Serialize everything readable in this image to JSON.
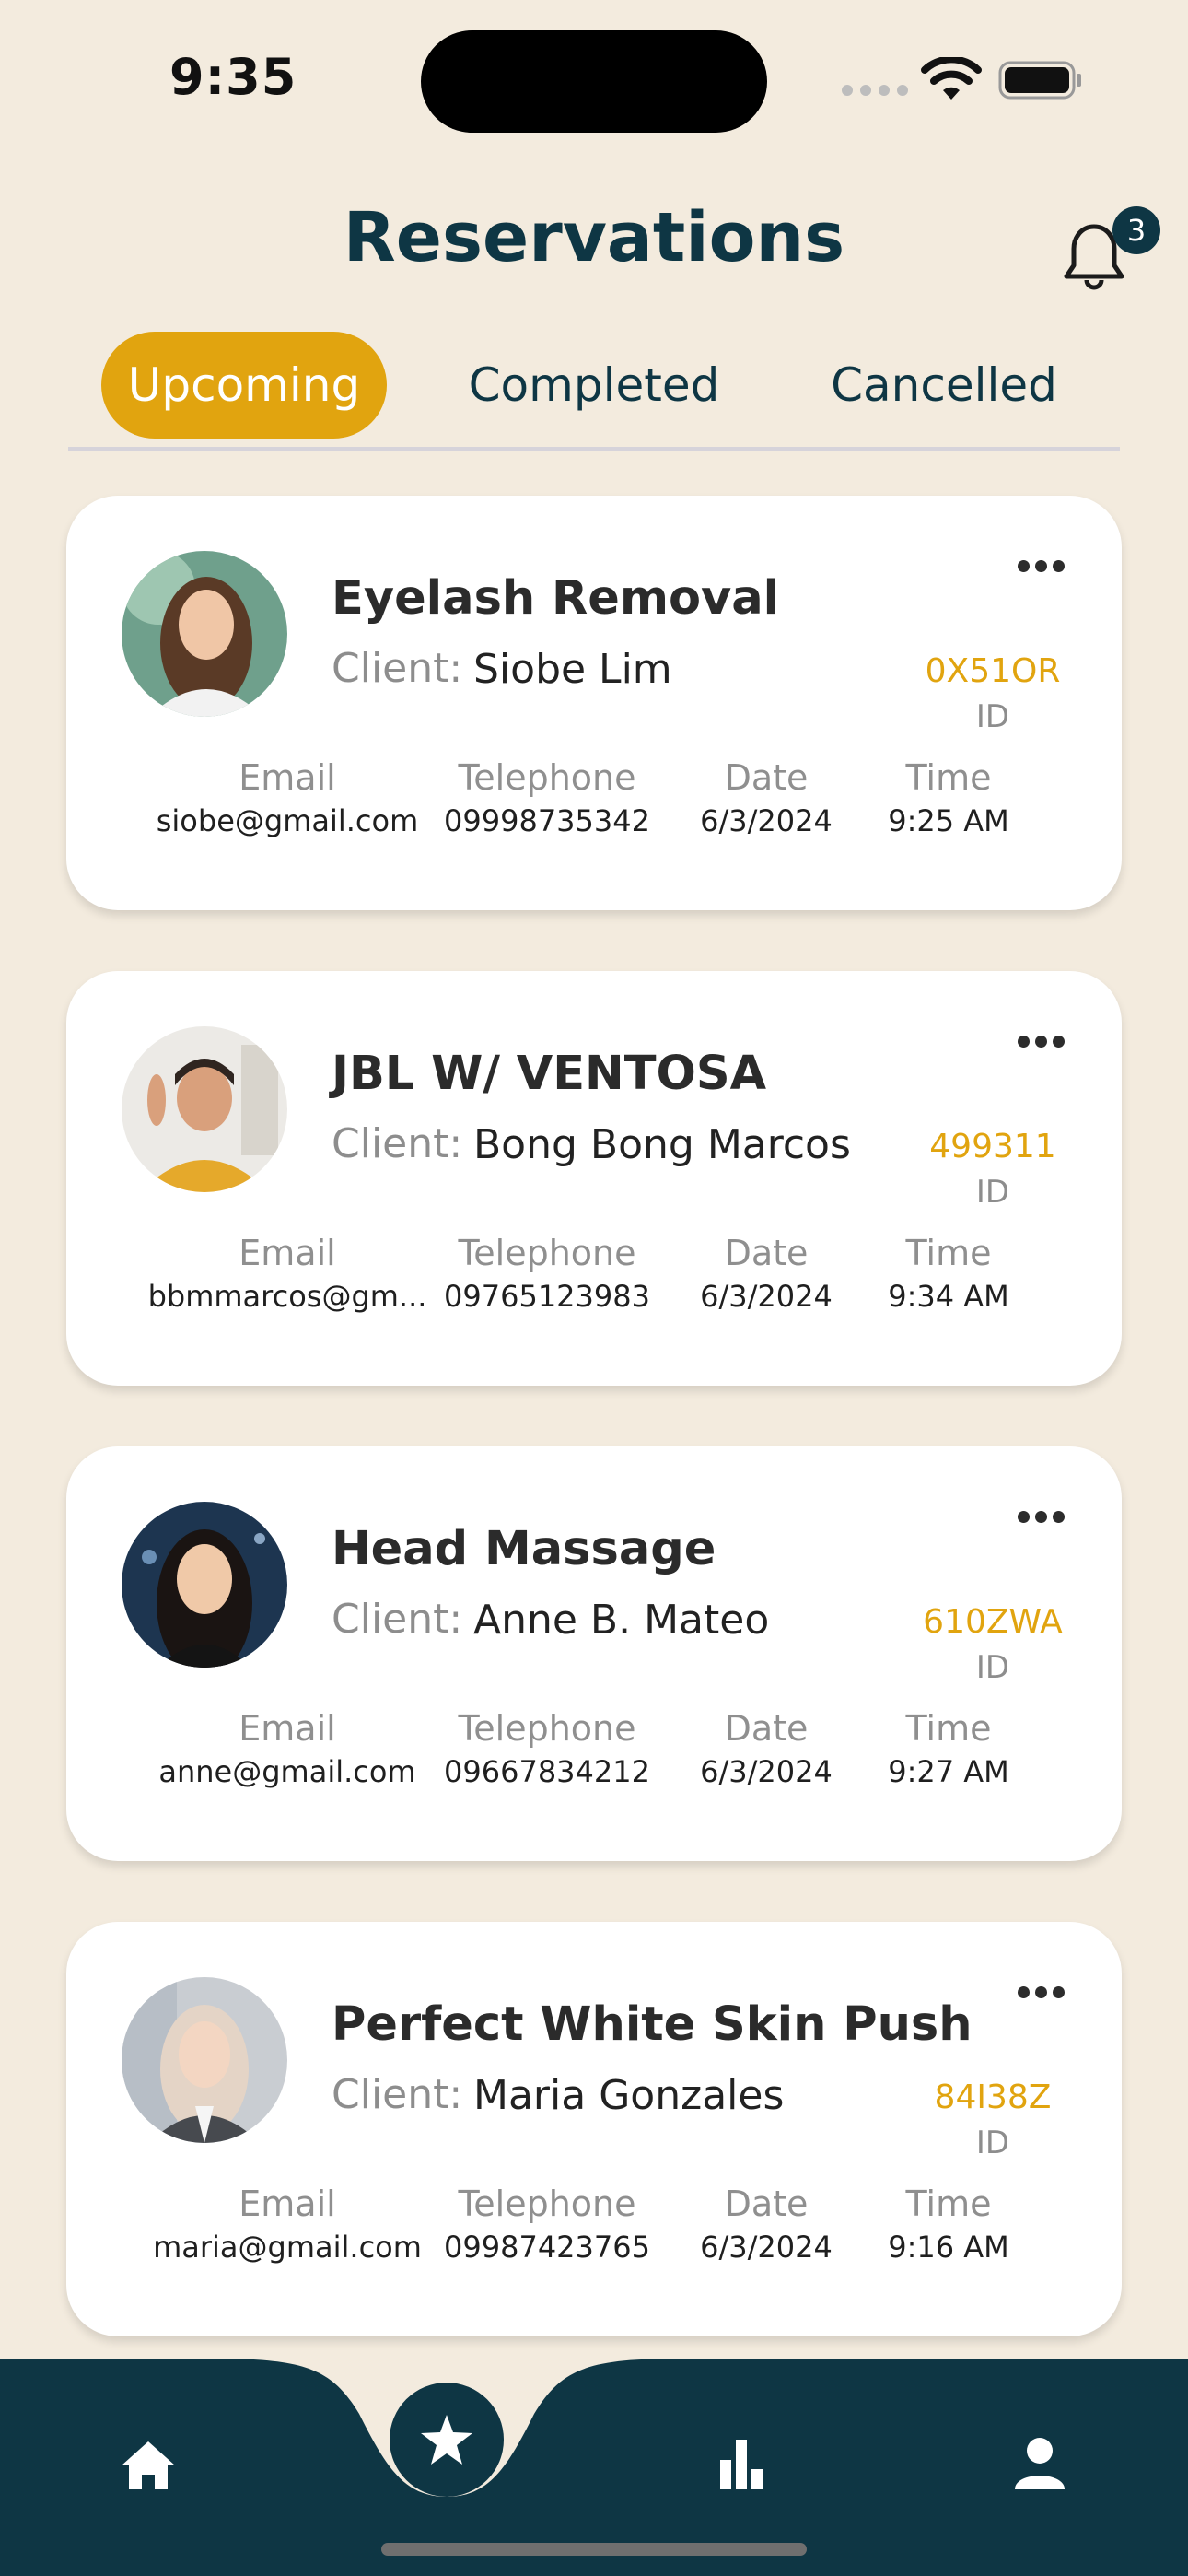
{
  "status_bar": {
    "time": "9:35"
  },
  "header": {
    "title": "Reservations",
    "notification_count": "3"
  },
  "tabs": [
    {
      "label": "Upcoming",
      "active": true
    },
    {
      "label": "Completed",
      "active": false
    },
    {
      "label": "Cancelled",
      "active": false
    }
  ],
  "columns": {
    "email": "Email",
    "telephone": "Telephone",
    "date": "Date",
    "time": "Time"
  },
  "client_label": "Client:",
  "id_label": "ID",
  "reservations": [
    {
      "service": "Eyelash Removal",
      "client": "Siobe Lim",
      "id": "0X51OR",
      "email": "siobe@gmail.com",
      "telephone": "09998735342",
      "date": "6/3/2024",
      "time": "9:25 AM"
    },
    {
      "service": "JBL W/ VENTOSA",
      "client": "Bong Bong Marcos",
      "id": "499311",
      "email": "bbmmarcos@gm...",
      "telephone": "09765123983",
      "date": "6/3/2024",
      "time": "9:34 AM"
    },
    {
      "service": "Head Massage",
      "client": "Anne B. Mateo",
      "id": "610ZWA",
      "email": "anne@gmail.com",
      "telephone": "09667834212",
      "date": "6/3/2024",
      "time": "9:27 AM"
    },
    {
      "service": "Perfect White Skin Push",
      "client": "Maria Gonzales",
      "id": "84I38Z",
      "email": "maria@gmail.com",
      "telephone": "09987423765",
      "date": "6/3/2024",
      "time": "9:16 AM"
    }
  ],
  "colors": {
    "background": "#f3ebde",
    "accent": "#e1a40f",
    "primary": "#0e3644",
    "card": "#ffffff"
  },
  "icons": {
    "nav": [
      "home-icon",
      "star-icon",
      "bar-chart-icon",
      "person-icon"
    ],
    "header": "bell-icon"
  }
}
